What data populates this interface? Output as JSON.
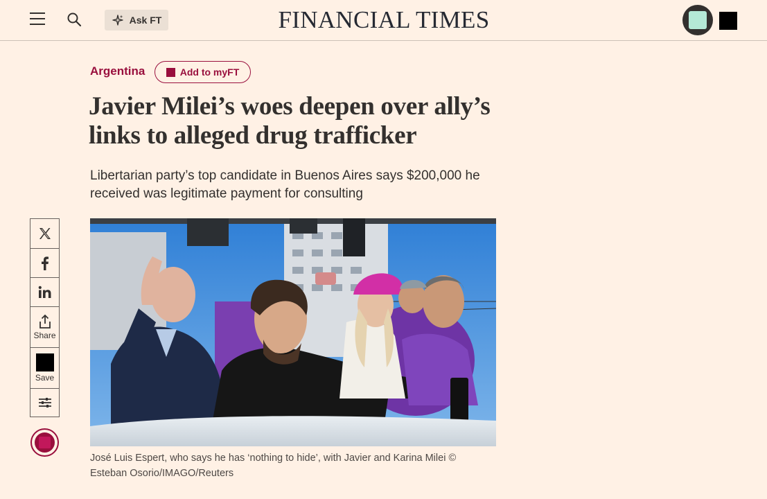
{
  "header": {
    "masthead": "FINANCIAL TIMES",
    "ask_ft_label": "Ask FT",
    "icons": [
      "menu-icon",
      "search-icon",
      "sparkle-icon",
      "avatar",
      "black-square"
    ]
  },
  "article": {
    "topic": "Argentina",
    "myft_label": "Add to myFT",
    "headline": "Javier Milei’s woes deepen over ally’s links to alleged drug trafficker",
    "standfirst": "Libertarian party’s top candidate in Buenos Aires says $200,000 he received was legitimate payment for consulting",
    "image_caption": "José Luis Espert, who says he has ‘nothing to hide’, with Javier and Karina Milei © Esteban Osorio/IMAGO/Reuters"
  },
  "share_bar": {
    "items": [
      {
        "icon": "x-icon",
        "label": ""
      },
      {
        "icon": "facebook-icon",
        "label": ""
      },
      {
        "icon": "linkedin-icon",
        "label": ""
      },
      {
        "icon": "share-icon",
        "label": "Share"
      },
      {
        "icon": "save-icon",
        "label": "Save"
      },
      {
        "icon": "settings-sliders-icon",
        "label": ""
      }
    ]
  },
  "colors": {
    "background": "#fff1e5",
    "accent": "#990f3d",
    "text": "#33302e"
  }
}
